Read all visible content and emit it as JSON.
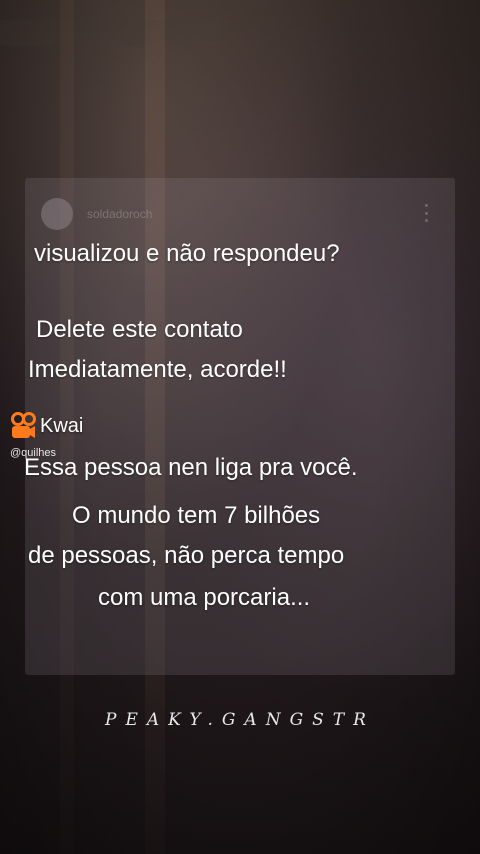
{
  "post": {
    "username": "soldadoroch",
    "lines": [
      "visualizou e não respondeu?",
      "Delete este contato",
      "Imediatamente, acorde!!",
      "Essa pessoa nen liga pra você.",
      "O mundo tem 7 bilhões",
      "de pessoas, não perca tempo",
      "com uma porcaria..."
    ]
  },
  "kwai": {
    "label": "Kwai",
    "handle": "@quilhes",
    "icon": "kwai-logo-icon",
    "color": "#FF7A1A"
  },
  "watermark": "PEAKY.GANGSTR"
}
